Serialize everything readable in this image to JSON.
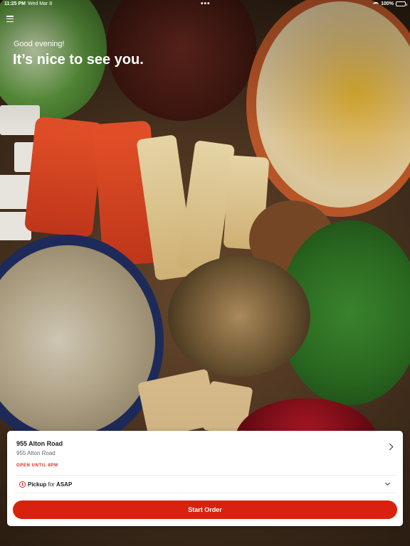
{
  "status_bar": {
    "time": "11:25 PM",
    "date": "Wed Mar 8",
    "battery": "100%"
  },
  "header": {
    "greeting": "Good evening!",
    "welcome": "It’s nice to see you."
  },
  "location": {
    "name": "955 Alton Road",
    "address": "955 Alton Road",
    "hours": "OPEN UNTIL 8PM"
  },
  "order": {
    "mode": "Pickup",
    "connector": "for",
    "time": "ASAP",
    "start_label": "Start Order"
  },
  "colors": {
    "accent": "#d8220f",
    "hours_text": "#d32a1a"
  },
  "icons": [
    "menu-icon",
    "wifi-icon",
    "battery-icon",
    "chevron-right-icon",
    "clock-icon",
    "chevron-down-icon"
  ]
}
